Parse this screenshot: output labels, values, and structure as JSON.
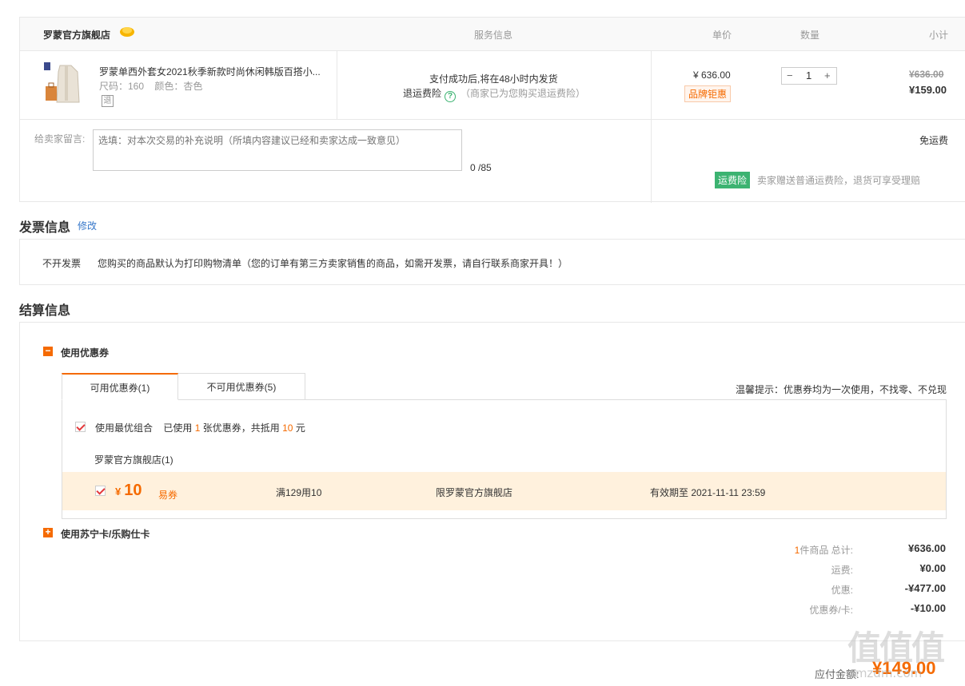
{
  "order": {
    "shop_name": "罗蒙官方旗舰店",
    "headers": {
      "service": "服务信息",
      "unit_price": "单价",
      "quantity": "数量",
      "subtotal": "小计"
    },
    "product": {
      "title": "罗蒙单西外套女2021秋季新款时尚休闲韩版百搭小...",
      "size": "尺码：160",
      "color": "颜色：杏色",
      "return_badge": "退",
      "shipping": "支付成功后,将在48小时内发货",
      "insurance_label": "退运费险",
      "insurance_icon": "help-icon",
      "insurance_note": "（商家已为您购买退运费险）",
      "unit_price": "¥ 636.00",
      "brand_tag": "品牌钜惠",
      "quantity": "1",
      "old_subtotal": "¥636.00",
      "new_subtotal": "¥159.00"
    },
    "message_label": "给卖家留言:",
    "message_placeholder": "选填：对本次交易的补充说明（所填内容建议已经和卖家达成一致意见）",
    "message_count": "0 /85",
    "free_shipping": "免运费",
    "freight_badge": "运费险",
    "freight_note": "卖家赠送普通运费险，退货可享受理赔"
  },
  "invoice": {
    "title": "发票信息",
    "edit": "修改",
    "type": "不开发票",
    "text": "您购买的商品默认为打印购物清单（您的订单有第三方卖家销售的商品，如需开发票，请自行联系商家开具！）"
  },
  "settlement": {
    "title": "结算信息",
    "coupon_toggle": "使用优惠券",
    "tabs": [
      "可用优惠券(1)",
      "不可用优惠券(5)"
    ],
    "tip": "温馨提示：优惠券均为一次使用，不找零、不兑现",
    "best_combo": "使用最优组合",
    "used_prefix": "已使用",
    "used_count": "1",
    "used_mid": "张优惠券，共抵用",
    "used_amount": "10",
    "used_suffix": "元",
    "store": "罗蒙官方旗舰店(1)",
    "coupon": {
      "currency": "¥",
      "amount": "10",
      "type": "易券",
      "rule": "满129用10",
      "limit": "限罗蒙官方旗舰店",
      "expiry": "有效期至 2021-11-11 23:59"
    },
    "card_toggle": "使用苏宁卡/乐购仕卡"
  },
  "summary": {
    "count": "1",
    "total_label": "件商品 总计:",
    "total": "¥636.00",
    "shipping_label": "运费:",
    "shipping": "¥0.00",
    "discount_label": "优惠:",
    "discount": "-¥477.00",
    "coupon_label": "优惠券/卡:",
    "coupon": "-¥10.00",
    "payable_label": "应付金额:",
    "payable": "¥149.00"
  },
  "watermark": {
    "logo": "值值值",
    "site": "smzdm.com"
  },
  "colors": {
    "accent": "#f56a00",
    "green": "#3cb371",
    "link": "#3677c9"
  }
}
